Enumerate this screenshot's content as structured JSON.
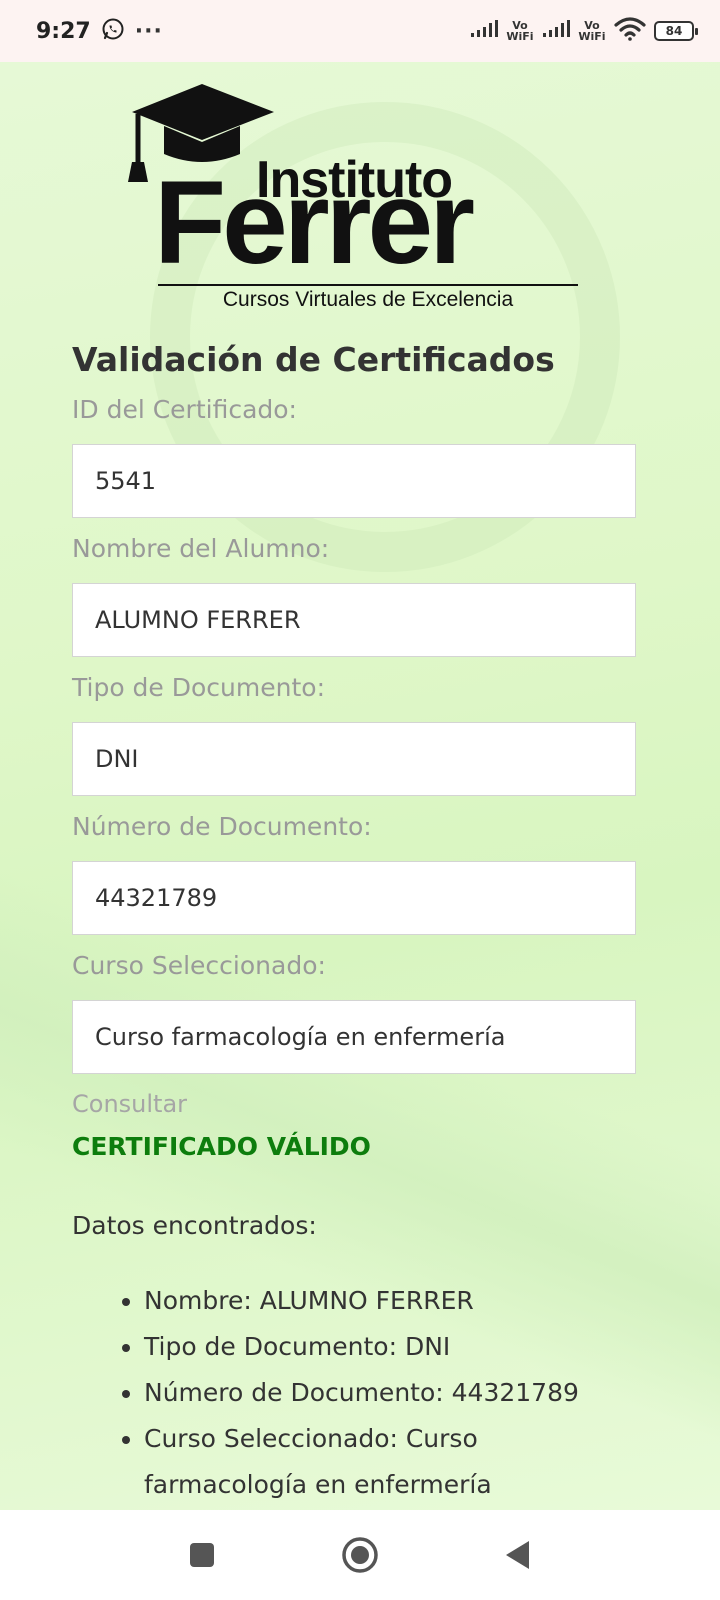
{
  "status_bar": {
    "time": "9:27",
    "more": "···",
    "vowifi_1": "Vo WiFi",
    "vowifi_2": "Vo WiFi",
    "battery": "84"
  },
  "logo": {
    "line1": "Instituto",
    "line2": "Ferrer",
    "tagline": "Cursos Virtuales de Excelencia"
  },
  "form": {
    "title": "Validación de Certificados",
    "fields": [
      {
        "label": "ID del Certificado:",
        "value": "5541"
      },
      {
        "label": "Nombre del Alumno:",
        "value": "ALUMNO FERRER"
      },
      {
        "label": "Tipo de Documento:",
        "value": "DNI"
      },
      {
        "label": "Número de Documento:",
        "value": "44321789"
      },
      {
        "label": "Curso Seleccionado:",
        "value": "Curso farmacología en enfermería"
      }
    ],
    "submit_label": "Consultar"
  },
  "result": {
    "status": "CERTIFICADO VÁLIDO",
    "heading": "Datos encontrados:",
    "items": [
      "Nombre: ALUMNO FERRER",
      "Tipo de Documento: DNI",
      "Número de Documento: 44321789",
      "Curso Seleccionado: Curso farmacología en enfermería"
    ]
  },
  "colors": {
    "valid_green": "#0d7d0d",
    "background": "#e2f8cf",
    "label_gray": "#999999"
  },
  "icons": {
    "status": [
      "whatsapp-icon",
      "signal-icon",
      "wifi-icon",
      "battery-icon"
    ],
    "nav": [
      "recents-square-icon",
      "home-circle-icon",
      "back-triangle-icon"
    ]
  }
}
